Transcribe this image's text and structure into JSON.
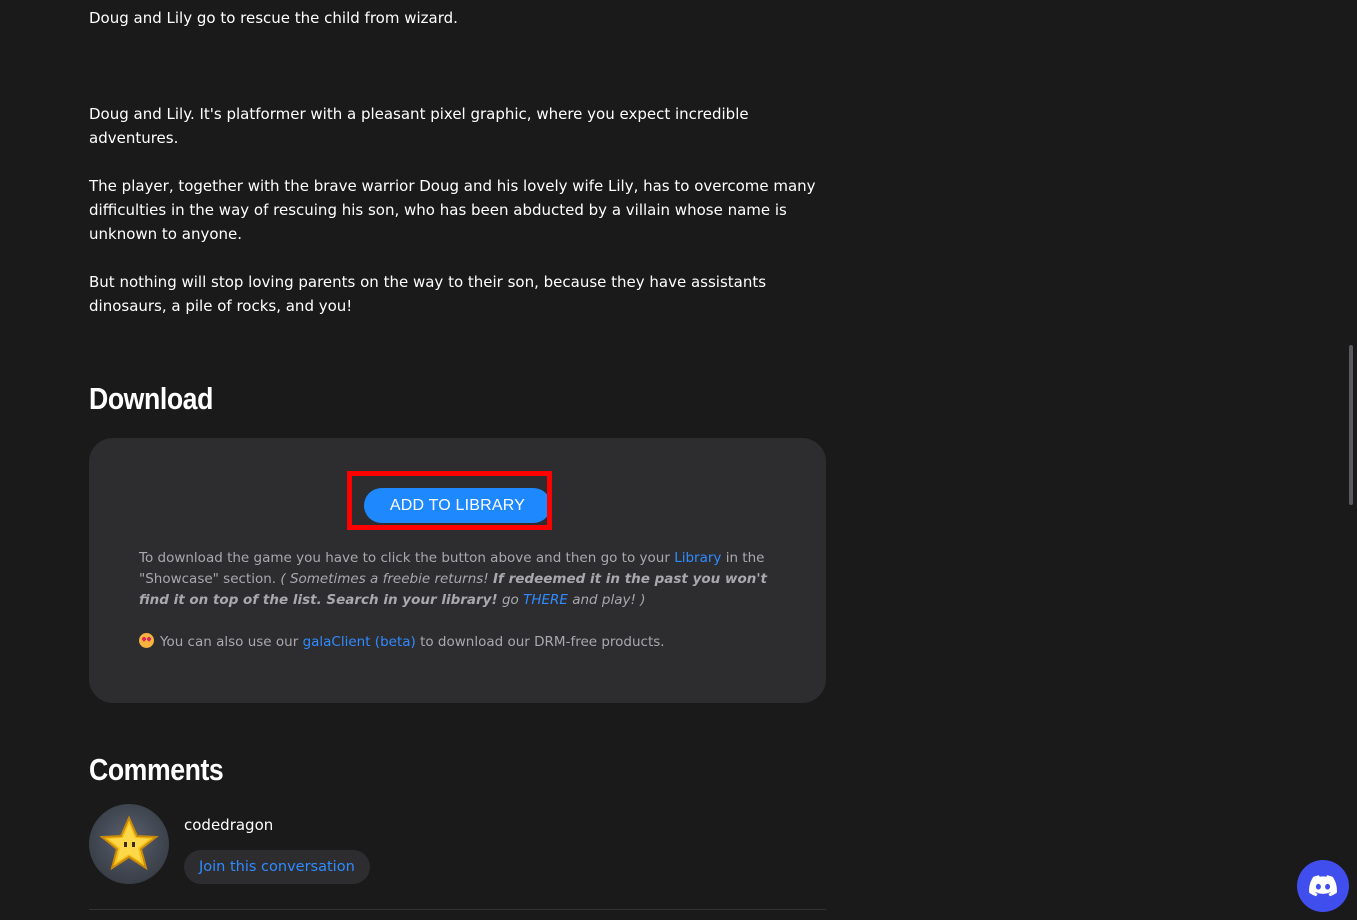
{
  "description": {
    "intro": "Doug and Lily go to rescue the child from wizard.",
    "paragraphs": [
      "Doug and Lily. It's platformer with a pleasant pixel graphic, where you expect incredible adventures.",
      "The player, together with the brave warrior Doug and his lovely wife Lily, has to overcome many difficulties in the way of rescuing his son, who has been abducted by a villain whose name is unknown to anyone.",
      "But nothing will stop loving parents on the way to their son, because they have assistants dinosaurs, a pile of rocks, and you!"
    ]
  },
  "download": {
    "title": "Download",
    "button_label": "ADD TO LIBRARY",
    "info_part1": "To download the game you have to click the button above and then go to your",
    "library_link": "Library",
    "info_part2": "in the \"Showcase\" section.",
    "info_italic1": "( Sometimes a freebie returns!",
    "info_bold": "If redeemed it in the past you won't find it on top of the list. Search in your library!",
    "info_italic2": "go",
    "there_link": "THERE",
    "info_italic3": "and play! )",
    "client_prefix": "You can also use our",
    "client_link": "galaClient (beta)",
    "client_suffix": "to download our DRM-free products."
  },
  "comments": {
    "title": "Comments",
    "username": "codedragon",
    "join_label": "Join this conversation"
  },
  "colors": {
    "background": "#1a1a1b",
    "panel": "#2d2d30",
    "accent": "#1e88ff",
    "link": "#2f8bff",
    "highlight": "#ff0000",
    "discord": "#404eed"
  },
  "icons": {
    "emoji": "star-struck-emoji-icon",
    "avatar": "pixel-star-avatar",
    "discord": "discord-icon"
  }
}
